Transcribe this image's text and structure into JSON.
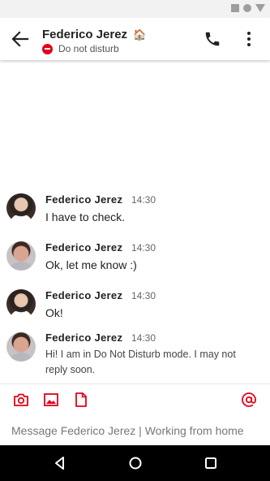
{
  "header": {
    "contact_name": "Federico Jerez",
    "contact_emoji": "🏠",
    "status_label": "Do not disturb"
  },
  "messages": [
    {
      "sender": "Federico Jerez",
      "time": "14:30",
      "text": "I have to check."
    },
    {
      "sender": "Federico Jerez",
      "time": "14:30",
      "text": "Ok, let me know :)"
    },
    {
      "sender": "Federico Jerez",
      "time": "14:30",
      "text": "Ok!"
    },
    {
      "sender": "Federico Jerez",
      "time": "14:30",
      "text": "Hi! I am in Do Not Disturb mode. I may not reply soon."
    }
  ],
  "composer": {
    "placeholder": "Message Federico Jerez | Working from home"
  },
  "icons": {
    "back": "arrow-left-icon",
    "call": "phone-icon",
    "more": "more-vert-icon",
    "camera": "camera-icon",
    "image": "image-icon",
    "file": "file-icon",
    "mention": "at-icon",
    "nav_back": "nav-back-icon",
    "nav_home": "nav-home-icon",
    "nav_recents": "nav-recents-icon"
  },
  "colors": {
    "accent": "#e2001a",
    "dnd": "#e2001a"
  }
}
